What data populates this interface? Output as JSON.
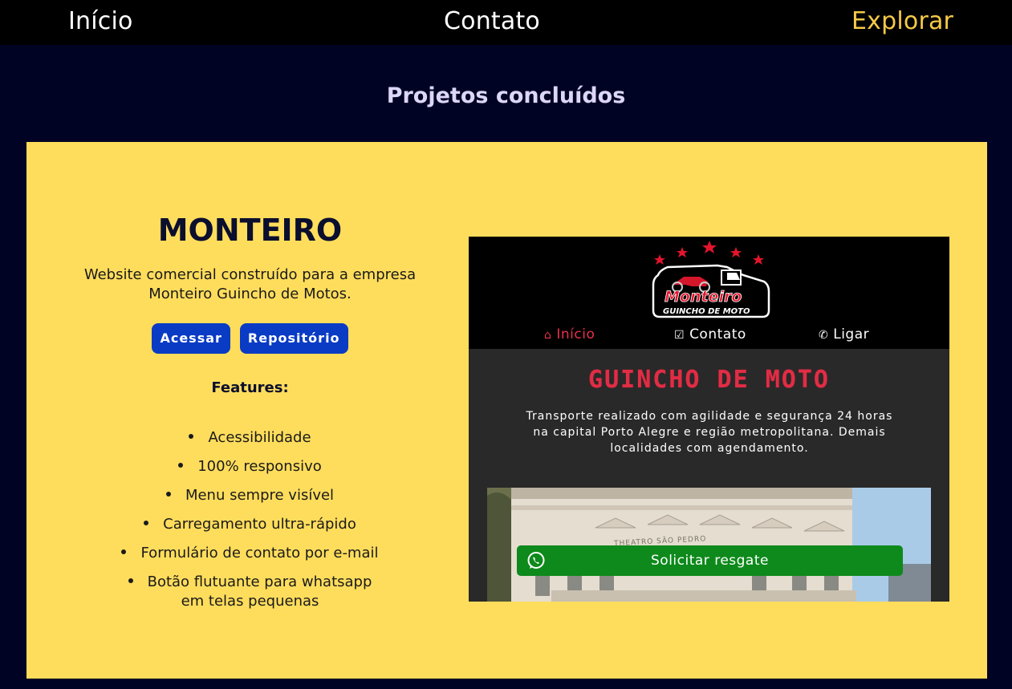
{
  "nav": {
    "inicio": "Início",
    "contato": "Contato",
    "explorar": "Explorar"
  },
  "section": {
    "title": "Projetos concluídos"
  },
  "project": {
    "title": "MONTEIRO",
    "description_line1": "Website comercial construído para a empresa",
    "description_line2": "Monteiro Guincho de Motos.",
    "access_label": "Acessar",
    "repo_label": "Repositório",
    "features_title": "Features:",
    "features": [
      "Acessibilidade",
      "100% responsivo",
      "Menu sempre visível",
      "Carregamento ultra-rápido",
      "Formulário de contato por e-mail",
      "Botão flutuante para whatsapp",
      "em telas pequenas"
    ]
  },
  "preview": {
    "logo_brand": "Monteiro",
    "logo_sub": "GUINCHO DE MOTO",
    "nav_inicio": "Início",
    "nav_contato": "Contato",
    "nav_ligar": "Ligar",
    "hero": "GUINCHO DE MOTO",
    "text_line1": "Transporte realizado com agilidade e segurança 24 horas",
    "text_line2": "na capital Porto Alegre e região metropolitana. Demais",
    "text_line3": "localidades com agendamento.",
    "photo_sign": "THEATRO SÃO PEDRO",
    "whatsapp_label": "Solicitar resgate"
  },
  "colors": {
    "page_bg": "#000324",
    "card_bg": "#ffdd5c",
    "button_bg": "#0a3bc4",
    "accent_explorar": "#f6c948",
    "preview_red": "#e02d45",
    "whatsapp_green": "#0d8a1b"
  }
}
